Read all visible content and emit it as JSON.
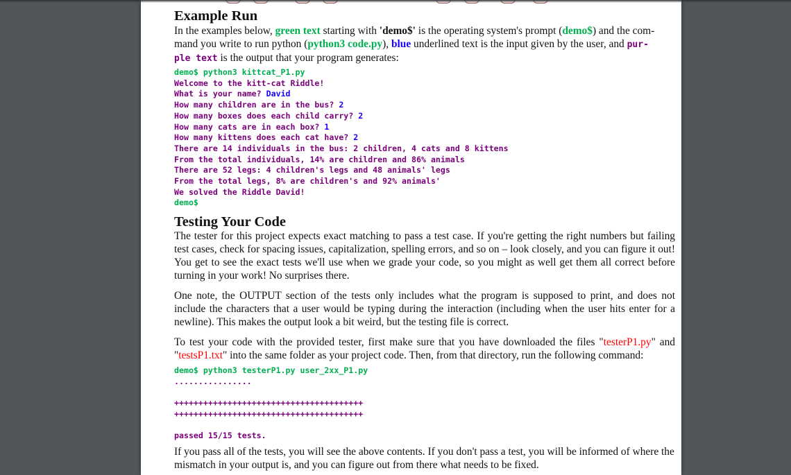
{
  "colors": {
    "prompt_green": "#00b050",
    "input_blue": "#1a00ff",
    "output_purple": "#7a007a",
    "filename_red": "#ff0000",
    "viewer_bg": "#525659"
  },
  "example_run": {
    "heading": "Example Run",
    "intro": {
      "t1": "In the examples below, ",
      "green_text": "green text",
      "t2": " starting with ",
      "demo_quoted": "'demo$'",
      "t3": " is the operating system's prompt (",
      "demo": "demo$",
      "t4": ") and the com-",
      "t5": "mand you write to run python (",
      "python_cmd": "python3 code.py",
      "t6": "), ",
      "blue": "blue",
      "t7": " underlined text is the input given by the user, and ",
      "purple_1": "pur-",
      "purple_2": "ple text",
      "t8": " is the output that your program generates:"
    },
    "transcript": {
      "command": "demo$ python3 kittcat_P1.py",
      "welcome": "Welcome to the kitt-cat Riddle!",
      "q_name": "What is your name? ",
      "a_name": "David",
      "q_children": "How many children are in the bus? ",
      "a_children": "2",
      "q_boxes": "How many boxes does each child carry? ",
      "a_boxes": "2",
      "q_cats": "How many cats are in each box? ",
      "a_cats": "1",
      "q_kittens": "How many kittens does each cat have? ",
      "a_kittens": "2",
      "out1": "There are 14 individuals in the bus: 2 children, 4 cats and 8 kittens",
      "out2": "From the total individuals, 14% are children and 86% animals",
      "out3": "There are 52 legs: 4 children's legs and 48 animals' legs",
      "out4": "From the total legs, 8% are children's and 92% animals'",
      "out5": "We solved the Riddle David!",
      "final_prompt": "demo$"
    }
  },
  "testing": {
    "heading": "Testing Your Code",
    "para1": "The tester for this project expects exact matching to pass a test case. If you're getting the right numbers but failing test cases, check for spacing issues, capitalization, spelling errors, and so on – look closely, and you can figure it out! You get to see the exact tests we'll use when we grade your code, so you might as well get them all correct before turning in your work! No surprises there.",
    "para2": "One note, the OUTPUT section of the tests only includes what the program is supposed to print, and does not include the characters that a user would be typing during the interaction (including when the user hits enter for a newline). This makes the output look a bit weird, but the testing file is correct.",
    "para3": {
      "t1": "To test your code with the provided tester, first make sure that you have downloaded the files \"",
      "file1": "testerP1.py",
      "t2": "\" and \"",
      "file2": "testsP1.txt",
      "t3": "\" into the same folder as your project code. Then, from that directory, run the following command:"
    },
    "tester_output": {
      "command": "demo$ python3 testerP1.py user_2xx_P1.py",
      "dots": "................",
      "plus1": "+++++++++++++++++++++++++++++++++++++++",
      "plus2": "+++++++++++++++++++++++++++++++++++++++",
      "result": "passed 15/15 tests."
    },
    "para4": "If you pass all of the tests, you will see the above contents. If you don't pass a test, you will be informed of where the mismatch in your output is, and you can figure out from there what needs to be fixed."
  }
}
